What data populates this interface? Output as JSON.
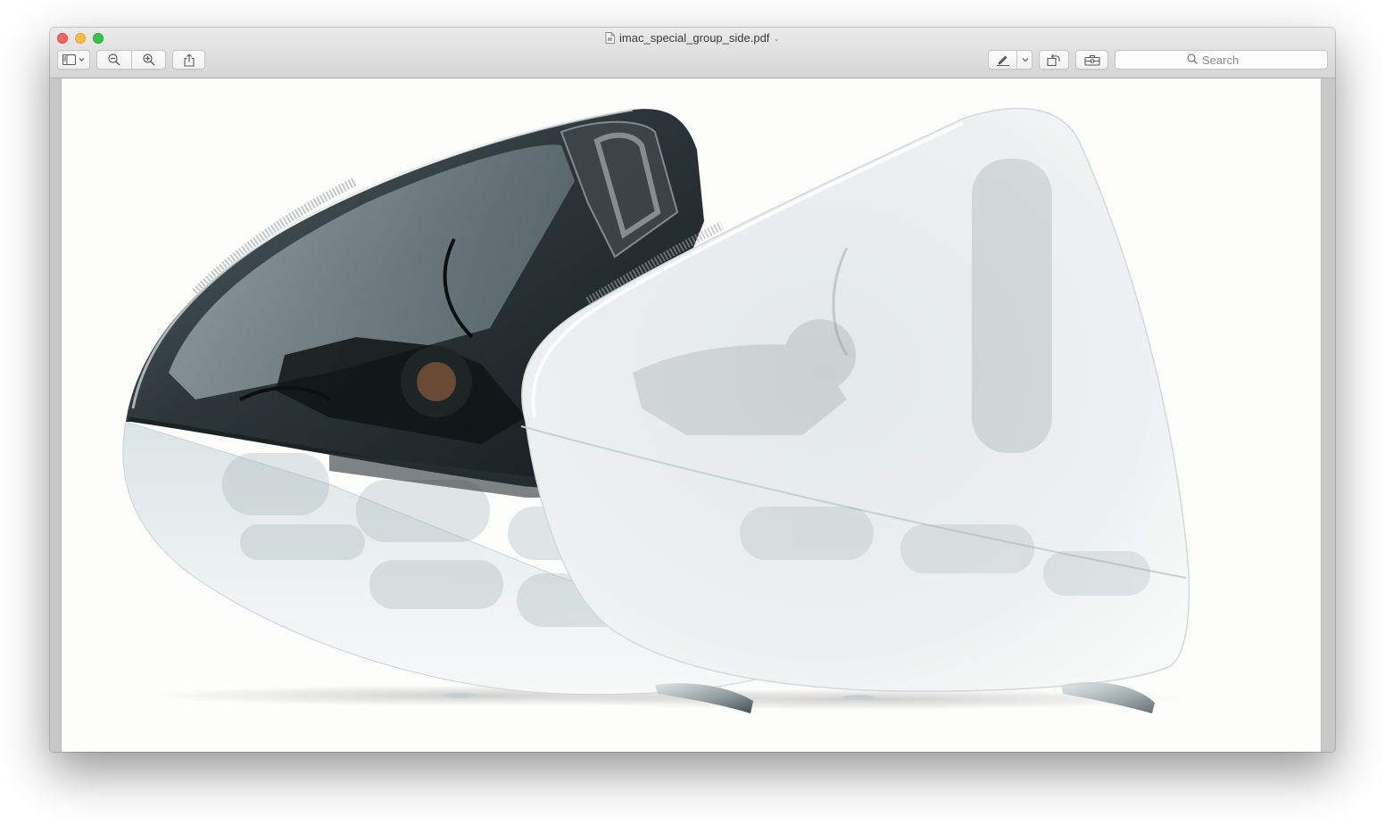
{
  "window": {
    "document_title": "imac_special_group_side.pdf",
    "traffic_lights": [
      "close",
      "minimize",
      "zoom"
    ]
  },
  "toolbar": {
    "left_buttons": [
      {
        "name": "sidebar-toggle-button",
        "icon": "sidebar-icon"
      },
      {
        "name": "zoom-out-button",
        "icon": "zoom-out-icon"
      },
      {
        "name": "zoom-in-button",
        "icon": "zoom-in-icon"
      },
      {
        "name": "share-button",
        "icon": "share-icon"
      }
    ],
    "right_buttons": [
      {
        "name": "markup-button",
        "icon": "pen-icon"
      },
      {
        "name": "rotate-button",
        "icon": "rotate-icon"
      },
      {
        "name": "toolbox-button",
        "icon": "toolbox-icon"
      }
    ],
    "search_placeholder": "Search"
  },
  "document": {
    "image_subject": "Two translucent iMac G3 computers seen from the side",
    "colors": {
      "page_background": "#fdfdfc",
      "graphite_shell": "#2f3a3d",
      "snow_shell": "#e9eceb"
    }
  }
}
